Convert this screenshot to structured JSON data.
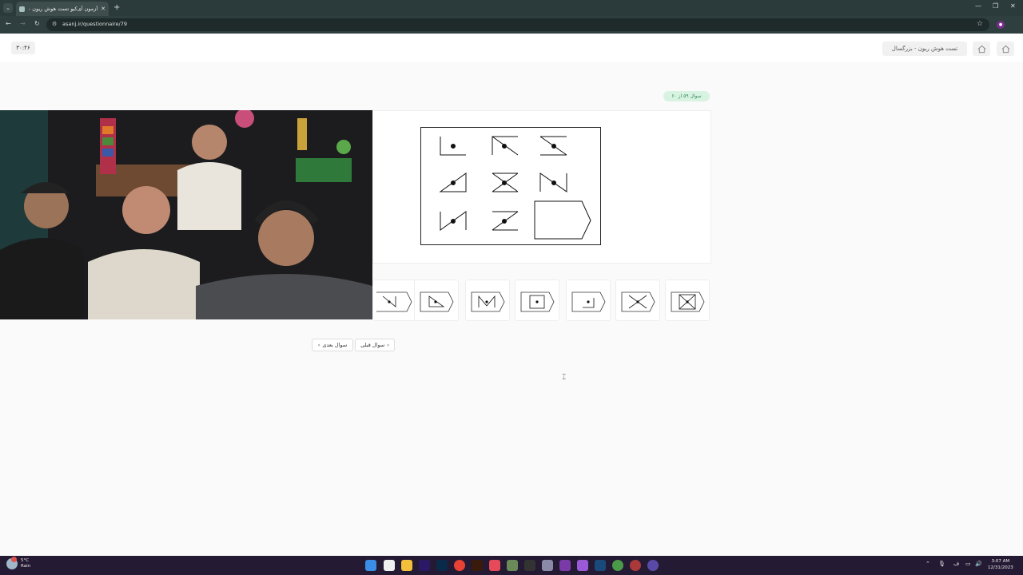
{
  "browser": {
    "tab_title": "آزمون آی‌کیو تست هوش ریون - بزرگ",
    "new_tab": "+",
    "url": "asanj.ir/questionnaire/79"
  },
  "header": {
    "timer": "۳۰:۴۶",
    "test_title": "تست هوش ریون - بزرگسال"
  },
  "question": {
    "badge": "سوال ۵۹ از ۶۰"
  },
  "nav": {
    "next_label": "سوال بعدی",
    "prev_label": "سوال قبلی"
  },
  "options": [
    "option-1",
    "option-2",
    "option-3",
    "option-4",
    "option-5",
    "option-6",
    "option-7"
  ],
  "taskbar": {
    "weather_temp": "5°C",
    "weather_desc": "Rain",
    "time": "3:07 AM",
    "date": "12/31/2023",
    "lang": "ف"
  },
  "colors": {
    "badge_bg": "#d9f3e2",
    "badge_text": "#2e8b57",
    "taskbar": "#241a33",
    "chrome": "#2b3a3a"
  }
}
